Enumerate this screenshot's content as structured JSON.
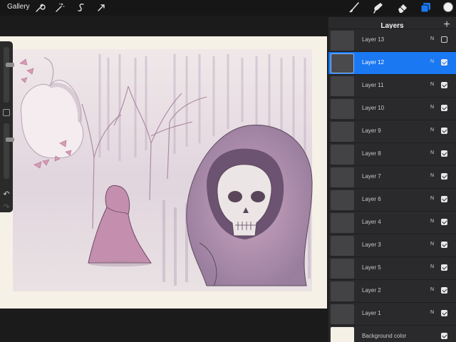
{
  "toolbar": {
    "gallery_label": "Gallery",
    "left_tools": [
      "wrench-icon",
      "magic-wand-icon",
      "selection-s-icon",
      "transform-arrow-icon"
    ],
    "right_tools": [
      "brush-icon",
      "smudge-icon",
      "eraser-icon",
      "layers-icon"
    ],
    "active_color": "#f2f2f2",
    "accent_color": "#1a78f2"
  },
  "sidebar": {
    "brush_size_level": 0.28,
    "opacity_level": 0.25,
    "modify_button_icon": "square-icon",
    "undo_icon": "undo-arrow-icon",
    "redo_icon": "redo-arrow-icon"
  },
  "layers_panel": {
    "title": "Layers",
    "add_icon": "plus-icon",
    "layers": [
      {
        "name": "Layer 13",
        "blend": "N",
        "visible": false,
        "active": false
      },
      {
        "name": "Layer 12",
        "blend": "N",
        "visible": true,
        "active": true
      },
      {
        "name": "Layer 11",
        "blend": "N",
        "visible": true,
        "active": false
      },
      {
        "name": "Layer 10",
        "blend": "N",
        "visible": true,
        "active": false
      },
      {
        "name": "Layer 9",
        "blend": "N",
        "visible": true,
        "active": false
      },
      {
        "name": "Layer 8",
        "blend": "N",
        "visible": true,
        "active": false
      },
      {
        "name": "Layer 7",
        "blend": "N",
        "visible": true,
        "active": false
      },
      {
        "name": "Layer 6",
        "blend": "N",
        "visible": true,
        "active": false
      },
      {
        "name": "Layer 4",
        "blend": "N",
        "visible": true,
        "active": false
      },
      {
        "name": "Layer 3",
        "blend": "N",
        "visible": true,
        "active": false
      },
      {
        "name": "Layer 5",
        "blend": "N",
        "visible": true,
        "active": false
      },
      {
        "name": "Layer 2",
        "blend": "N",
        "visible": true,
        "active": false
      },
      {
        "name": "Layer 1",
        "blend": "N",
        "visible": true,
        "active": false
      }
    ],
    "background": {
      "name": "Background color",
      "visible": true,
      "color": "#f6f1e6"
    }
  }
}
